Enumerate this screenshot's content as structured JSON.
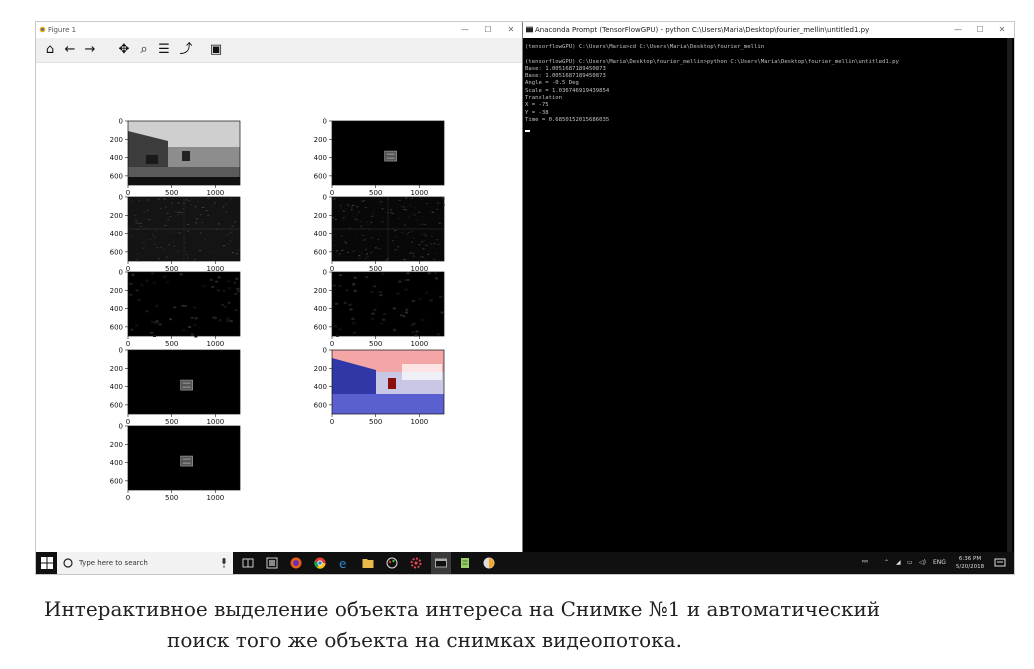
{
  "figure_window": {
    "title": "Figure 1",
    "controls": {
      "minimize": "—",
      "maximize": "☐",
      "close": "✕"
    },
    "toolbar": [
      {
        "name": "home-icon",
        "glyph": "⌂"
      },
      {
        "name": "back-icon",
        "glyph": "←"
      },
      {
        "name": "forward-icon",
        "glyph": "→"
      },
      {
        "name": "pan-icon",
        "glyph": "✥"
      },
      {
        "name": "zoom-icon",
        "glyph": "⌕"
      },
      {
        "name": "subplots-icon",
        "glyph": "☰"
      },
      {
        "name": "edit-axis-icon",
        "glyph": "⤴"
      },
      {
        "name": "save-icon",
        "glyph": "▣"
      }
    ],
    "plots": [
      {
        "id": "p1",
        "kind": "road",
        "yticks": [
          "0",
          "200",
          "400",
          "600"
        ],
        "xticks": [
          "0",
          "500",
          "1000"
        ]
      },
      {
        "id": "p2",
        "kind": "box",
        "yticks": [
          "0",
          "200",
          "400",
          "600"
        ],
        "xticks": [
          "0",
          "500",
          "1000"
        ]
      },
      {
        "id": "p3",
        "kind": "noise",
        "yticks": [
          "0",
          "200",
          "400",
          "600"
        ],
        "xticks": [
          "0",
          "500",
          "1000"
        ]
      },
      {
        "id": "p4",
        "kind": "noise2",
        "yticks": [
          "0",
          "200",
          "400",
          "600"
        ],
        "xticks": [
          "0",
          "500",
          "1000"
        ]
      },
      {
        "id": "p5",
        "kind": "dark",
        "yticks": [
          "0",
          "200",
          "400",
          "600"
        ],
        "xticks": [
          "0",
          "500",
          "1000"
        ]
      },
      {
        "id": "p6",
        "kind": "dark",
        "yticks": [
          "0",
          "200",
          "400",
          "600"
        ],
        "xticks": [
          "0",
          "500",
          "1000"
        ]
      },
      {
        "id": "p7",
        "kind": "box",
        "yticks": [
          "0",
          "200",
          "400",
          "600"
        ],
        "xticks": [
          "0",
          "500",
          "1000"
        ]
      },
      {
        "id": "p8",
        "kind": "color",
        "yticks": [
          "0",
          "200",
          "400",
          "600"
        ],
        "xticks": [
          "0",
          "500",
          "1000"
        ]
      },
      {
        "id": "p9",
        "kind": "box",
        "yticks": [
          "0",
          "200",
          "400",
          "600"
        ],
        "xticks": [
          "0",
          "500",
          "1000"
        ]
      }
    ]
  },
  "console_window": {
    "title": "Anaconda Prompt (TensorFlowGPU) - python  C:\\Users\\Maria\\Desktop\\fourier_mellin\\untitled1.py",
    "controls": {
      "minimize": "—",
      "maximize": "☐",
      "close": "✕"
    },
    "lines": [
      "(tensorflowGPU) C:\\Users\\Maria>cd C:\\Users\\Maria\\Desktop\\fourier_mellin",
      "",
      "(tensorflowGPU) C:\\Users\\Maria\\Desktop\\fourier_mellin>python C:\\Users\\Maria\\Desktop\\fourier_mellin\\untitled1.py",
      "Base: 1.0051687189450873",
      "Base: 1.0051687189450873",
      "Angle = -0.5 Deg",
      "Scale = 1.036746919439854",
      "Translation",
      "X = -75",
      "Y = -38",
      "Time = 0.6850152015686035"
    ]
  },
  "taskbar": {
    "search_placeholder": "Type here to search",
    "tray_lang": "ENG",
    "time": "6:36 PM",
    "date": "5/20/2018"
  },
  "caption": {
    "line1": "Интерактивное выделение объекта интереса на Снимке №1 и автоматический",
    "line2": "поиск того же объекта на снимках видеопотока."
  }
}
